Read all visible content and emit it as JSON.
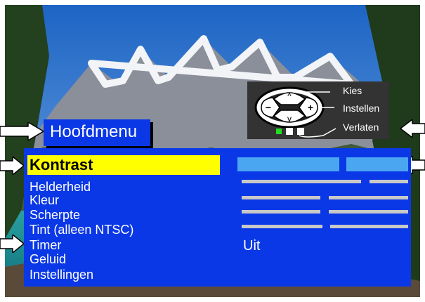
{
  "menu_title": "Hoofdmenu",
  "remote_legend": {
    "select": "Kies",
    "adjust": "Instellen",
    "exit": "Verlaten",
    "up_symbol": "^",
    "down_symbol": "v",
    "minus_symbol": "−",
    "plus_symbol": "+"
  },
  "menu_items": [
    "Kontrast",
    "Helderheid",
    "Kleur",
    "Scherpte",
    "Tint (alleen NTSC)",
    "Timer",
    "Geluid",
    "Instellingen"
  ],
  "timer_value": "Uit",
  "colors": {
    "menu_blue": "#0a38e6",
    "highlight_yellow": "#ffff00",
    "bar_light_blue": "#4aa6f0",
    "bar_gray": "#c8c8c8",
    "legend_bg": "#333333"
  }
}
